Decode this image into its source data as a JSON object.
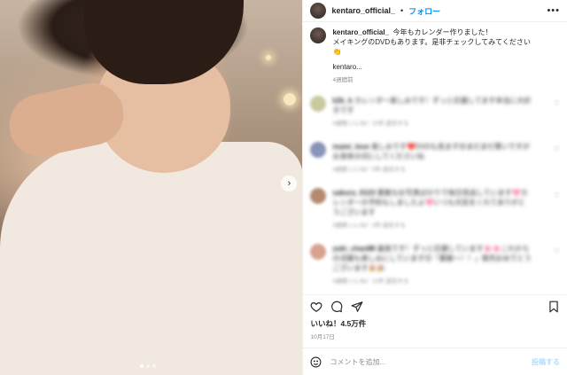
{
  "post": {
    "username": "kentaro_official_",
    "separator": "•",
    "follow_label": "フォロー",
    "more_label": "•••",
    "photo_dots": 3
  },
  "caption": {
    "username": "kentaro_official_",
    "line1": "今年もカレンダー作りました！",
    "line2": "メイキングのDVDもあります。是非チェックしてみてください",
    "emoji": "👏",
    "sign": "kentaro...",
    "time": "4週間前"
  },
  "comments": [
    {
      "user": "k2k_k",
      "text": "カレンダー楽しみです！ずっと応援してます本当に大好きです",
      "meta": "4週間  いいね！10件  返信する",
      "avatar_color": "#c9c9a0"
    },
    {
      "user": "mami_love",
      "text": "楽しみです❤️DVDも見ます😍まだまだ寒いですがお身体大切にしてくださいね",
      "meta": "4週間  いいね！5件  返信する",
      "avatar_color": "#8a94b8"
    },
    {
      "user": "sakura_0123",
      "text": "素敵なお写真ばかりで毎日見返しています🩷カレンダーの予約もしましたよ🩷いつも元気をくれてありがとうございます",
      "meta": "4週間  いいね！3件  返信する",
      "avatar_color": "#b48a70"
    },
    {
      "user": "yuki_chan88",
      "text": "最高です！ずっと応援しています🌸🌸これからの活躍も楽しみにしています😊「素敵〜！！」発売おめでとうございます🎉🎉",
      "meta": "4週間  いいね！12件  返信する",
      "avatar_color": "#d7a28e"
    }
  ],
  "actions": {
    "like_icon": "heart-icon",
    "comment_icon": "comment-icon",
    "share_icon": "paper-plane-icon",
    "save_icon": "bookmark-icon"
  },
  "likes_label": "いいね！4.5万件",
  "date_label": "10月17日",
  "add_comment": {
    "placeholder": "コメントを追加...",
    "post_label": "投稿する"
  },
  "colors": {
    "accent": "#0095f6",
    "post_disabled": "#b2dffc",
    "muted": "#8e8e8e"
  }
}
